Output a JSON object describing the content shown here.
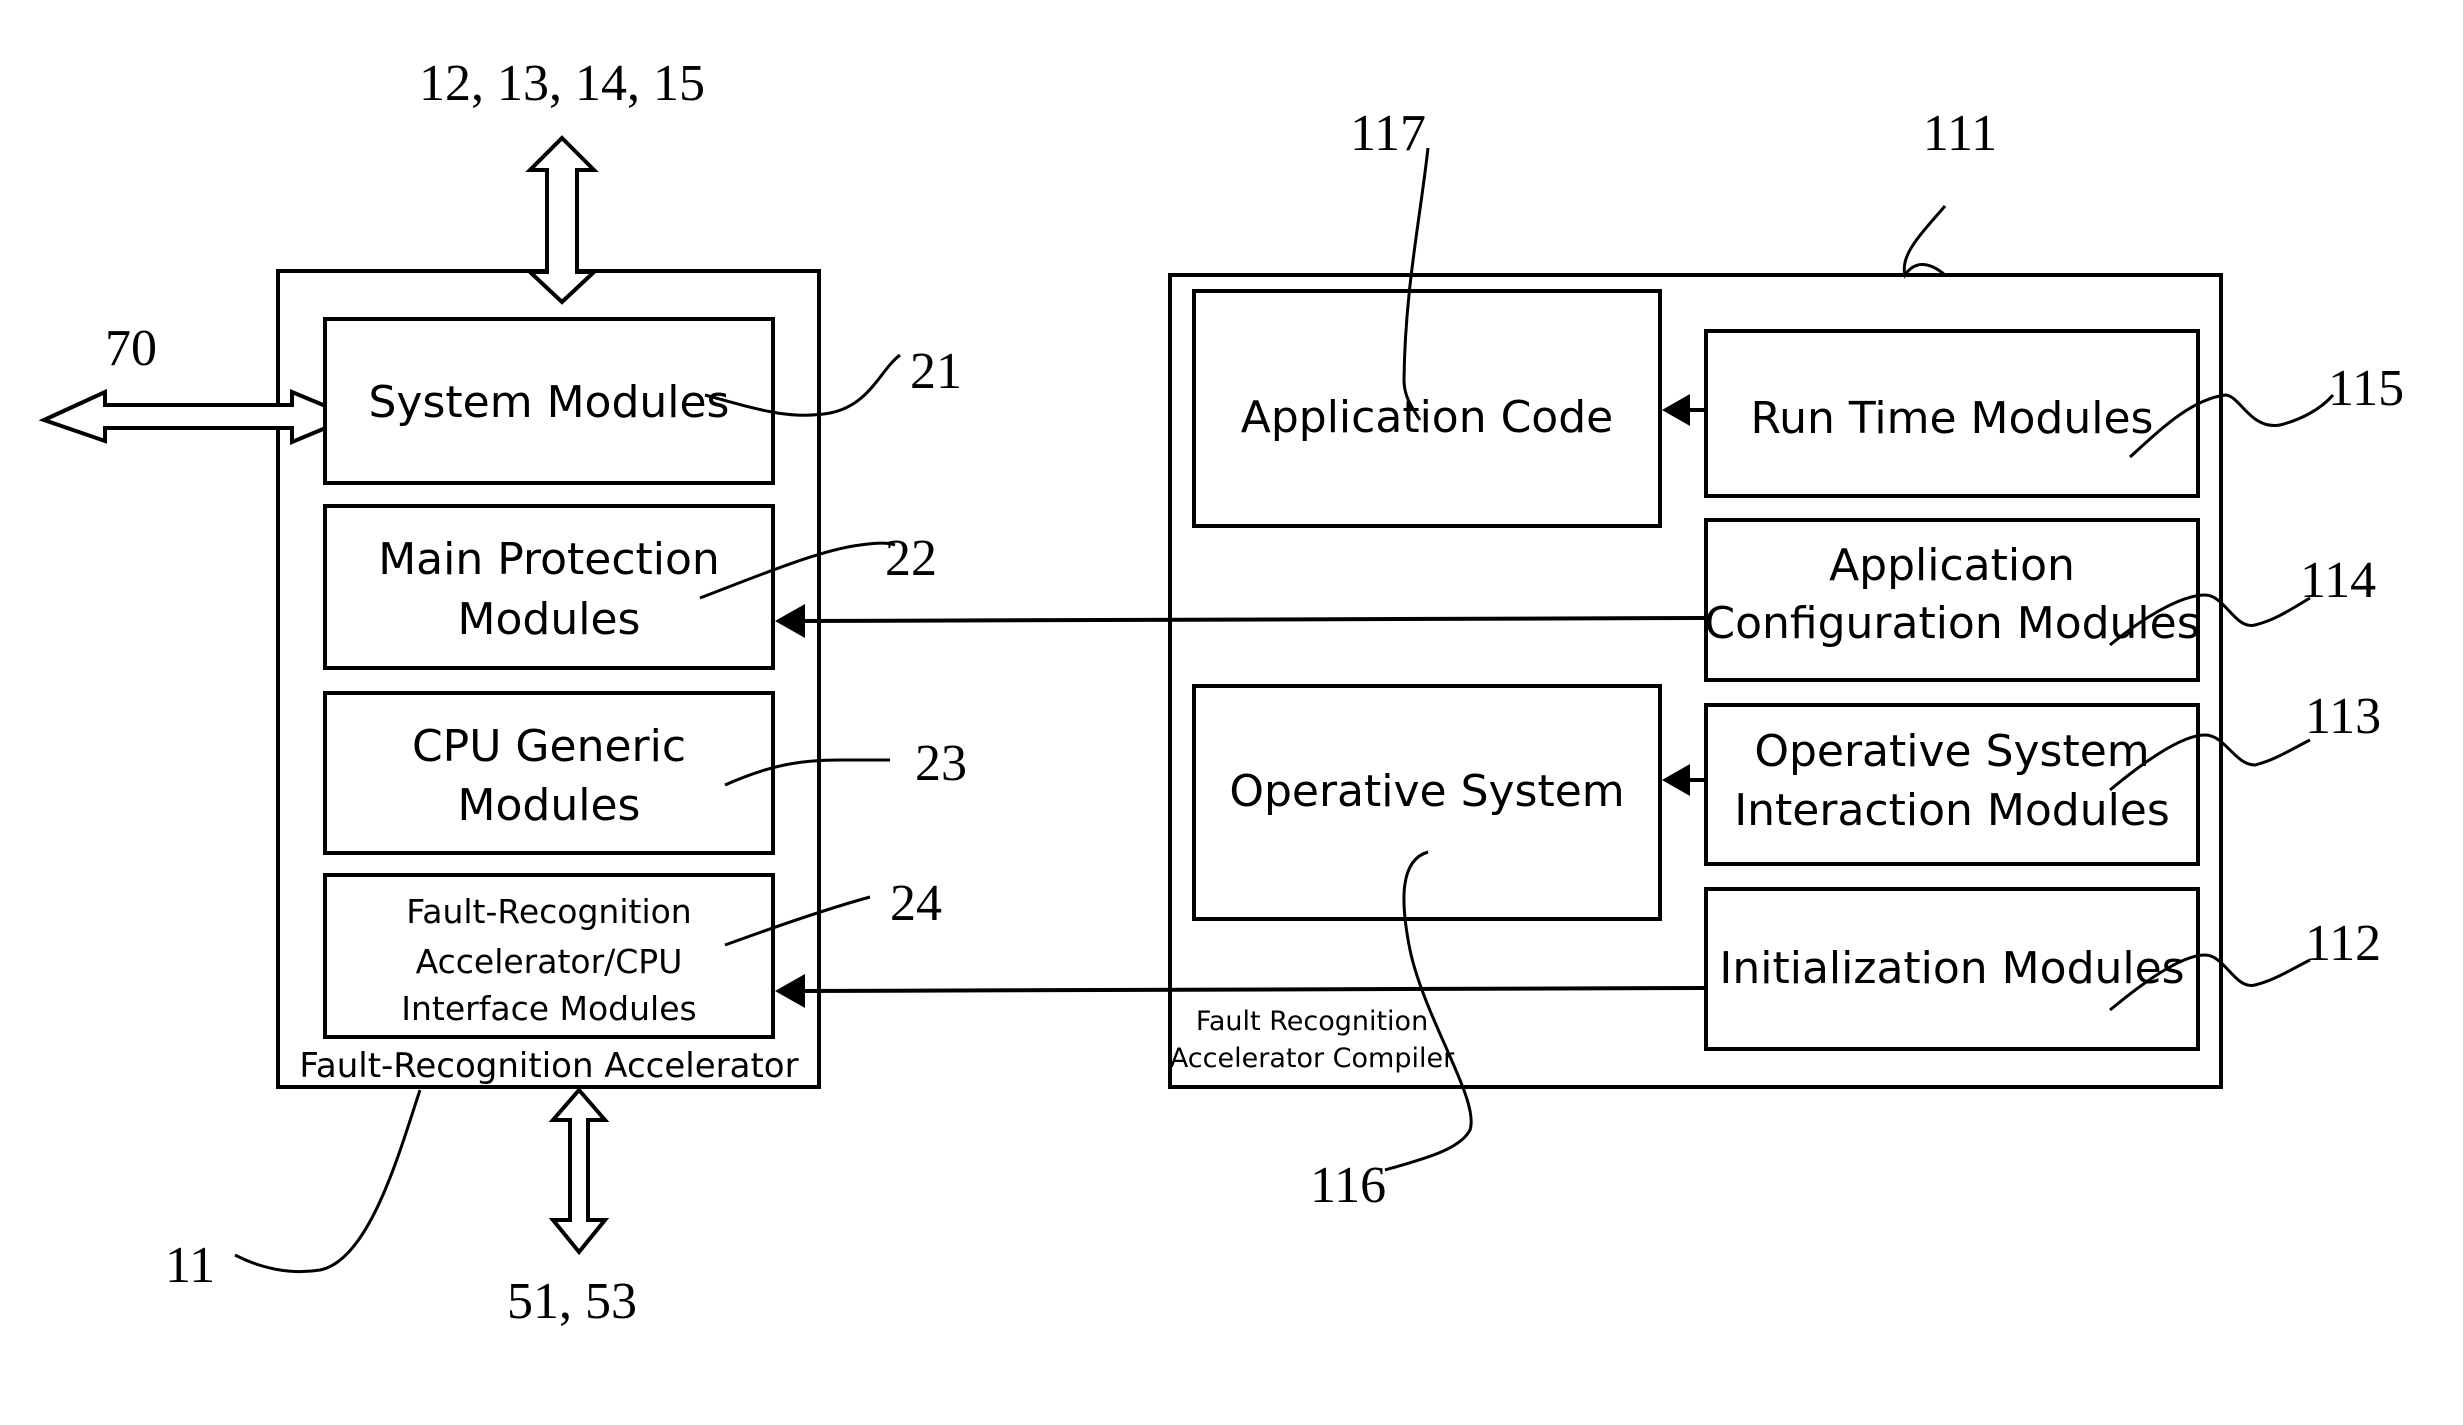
{
  "figure": {
    "fault_recognition_accelerator": {
      "ref": "11",
      "caption": "Fault-Recognition Accelerator",
      "bus_top_ref": "12, 13, 14, 15",
      "bus_left_ref": "70",
      "bus_bottom_ref": "51, 53",
      "modules": [
        {
          "ref": "21",
          "lines": [
            "System Modules"
          ]
        },
        {
          "ref": "22",
          "lines": [
            "Main Protection",
            "Modules"
          ]
        },
        {
          "ref": "23",
          "lines": [
            "CPU Generic",
            "Modules"
          ]
        },
        {
          "ref": "24",
          "lines": [
            "Fault-Recognition",
            "Accelerator/CPU",
            "Interface Modules"
          ]
        }
      ]
    },
    "compiler": {
      "ref": "111",
      "caption_lines": [
        "Fault Recognition",
        "Accelerator Compiler"
      ],
      "application_code": {
        "ref": "117",
        "label": "Application Code"
      },
      "operative_system": {
        "ref": "116",
        "label": "Operative System"
      },
      "modules": [
        {
          "ref": "115",
          "lines": [
            "Run Time Modules"
          ]
        },
        {
          "ref": "114",
          "lines": [
            "Application",
            "Configuration Modules"
          ]
        },
        {
          "ref": "113",
          "lines": [
            "Operative System",
            "Interaction Modules"
          ]
        },
        {
          "ref": "112",
          "lines": [
            "Initialization Modules"
          ]
        }
      ]
    },
    "connections": [
      {
        "from": "Run Time Modules",
        "to": "Application Code"
      },
      {
        "from": "Application Configuration Modules",
        "to": "Main Protection Modules"
      },
      {
        "from": "Operative System Interaction Modules",
        "to": "Operative System"
      },
      {
        "from": "Initialization Modules",
        "to": "Fault-Recognition Accelerator/CPU Interface Modules"
      }
    ]
  }
}
